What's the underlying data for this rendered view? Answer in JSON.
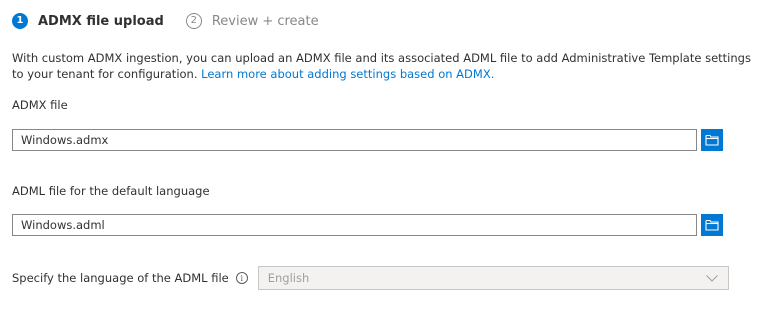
{
  "steps": [
    {
      "number": "1",
      "label": "ADMX file upload"
    },
    {
      "number": "2",
      "label": "Review + create"
    }
  ],
  "description": {
    "text": "With custom ADMX ingestion, you can upload an ADMX file and its associated ADML file to add Administrative Template settings to your tenant for configuration. ",
    "link": "Learn more about adding settings based on ADMX."
  },
  "admx": {
    "label": "ADMX file",
    "value": "Windows.admx",
    "browse_icon": "folder-icon"
  },
  "adml": {
    "label": "ADML file for the default language",
    "value": "Windows.adml",
    "browse_icon": "folder-icon"
  },
  "language": {
    "label": "Specify the language of the ADML file",
    "info_icon": "info-icon",
    "selected": "English",
    "disabled": true
  },
  "colors": {
    "accent": "#0078d4",
    "text": "#323130",
    "disabled_bg": "#f3f2f1",
    "disabled_text": "#a19f9d"
  }
}
